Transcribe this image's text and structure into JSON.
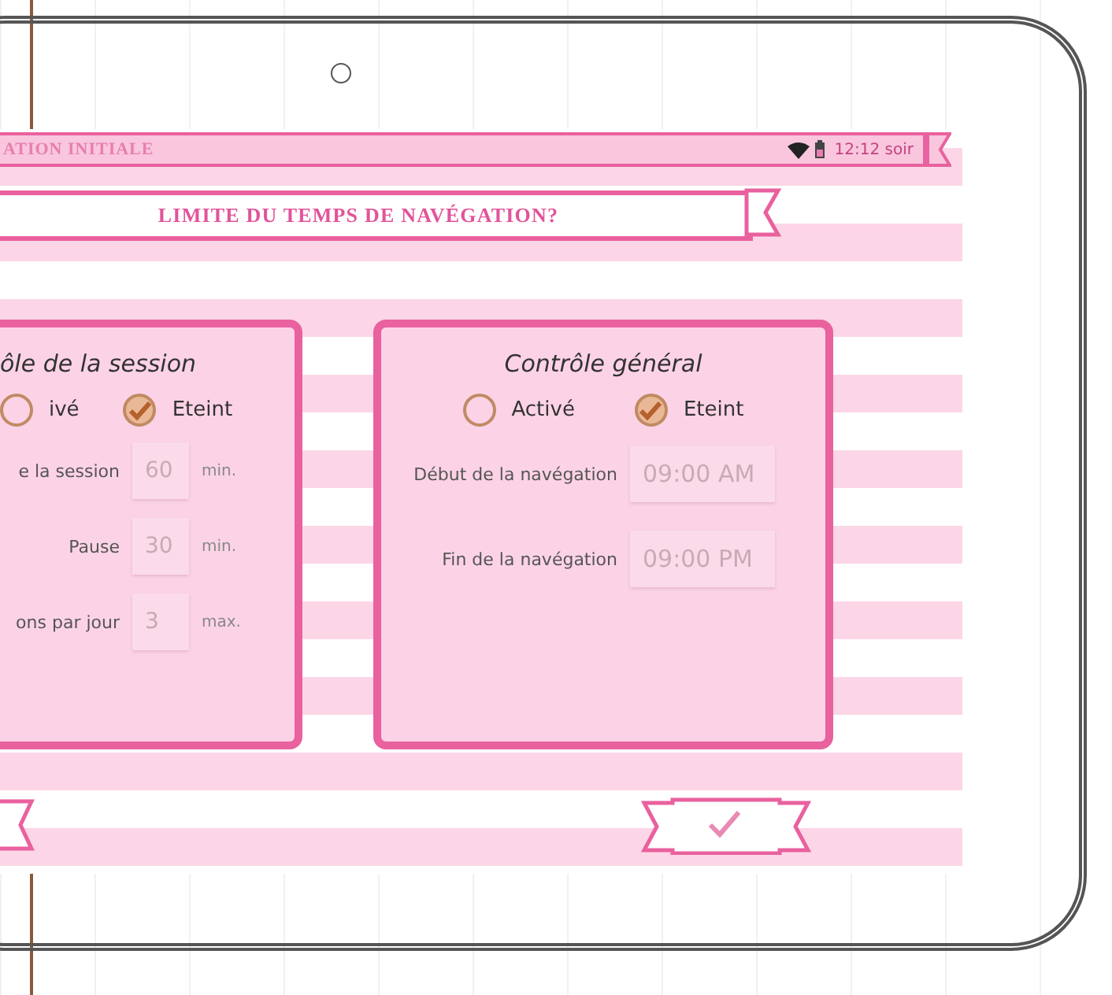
{
  "status_bar": {
    "title": "ATION INITIALE",
    "time": "12:12 soir"
  },
  "heading": "LIMITE DU TEMPS DE NAVÉGATION?",
  "panels": [
    {
      "title": "ôle de la session",
      "options": [
        {
          "label": "ivé",
          "selected": false
        },
        {
          "label": "Eteint",
          "selected": true
        }
      ],
      "rows": [
        {
          "label": "e la session",
          "value": "60",
          "unit": "min."
        },
        {
          "label": "Pause",
          "value": "30",
          "unit": "min."
        },
        {
          "label": "ons par jour",
          "value": "3",
          "unit": "max."
        }
      ]
    },
    {
      "title": "Contrôle général",
      "options": [
        {
          "label": "Activé",
          "selected": false
        },
        {
          "label": "Eteint",
          "selected": true
        }
      ],
      "rows": [
        {
          "label": "Début de la navégation",
          "value": "09:00 AM"
        },
        {
          "label": "Fin de la navégation",
          "value": "09:00 PM"
        }
      ]
    }
  ]
}
